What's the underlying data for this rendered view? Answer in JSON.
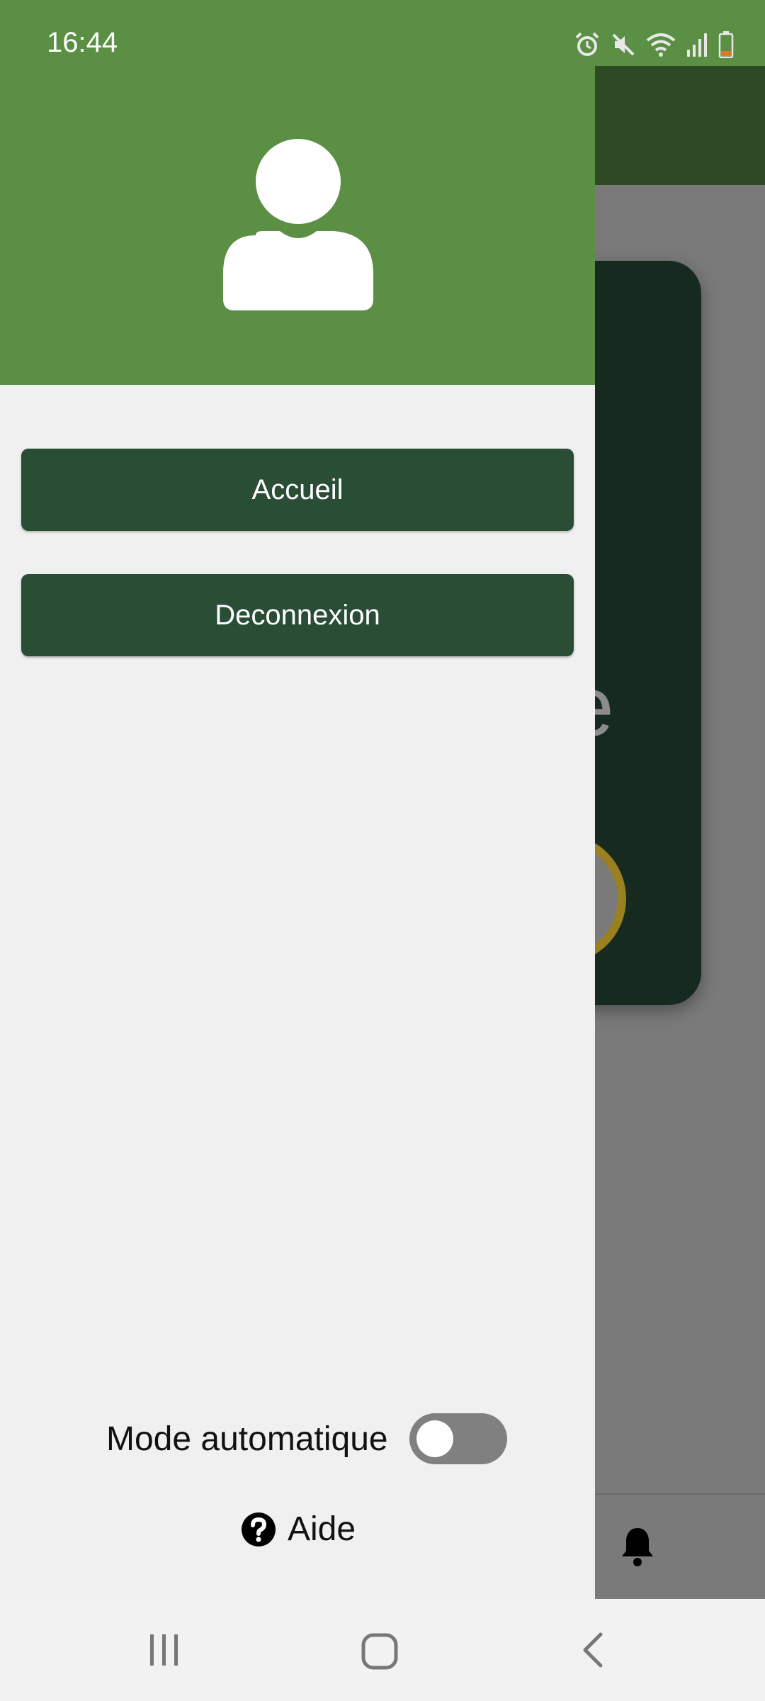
{
  "status_bar": {
    "time": "16:44",
    "icons": [
      "alarm-icon",
      "mute-icon",
      "wifi-icon",
      "signal-icon",
      "battery-low-icon"
    ]
  },
  "background": {
    "card_letter": "e"
  },
  "drawer": {
    "avatar_icon": "user-avatar-icon",
    "buttons": {
      "home_label": "Accueil",
      "logout_label": "Deconnexion"
    },
    "auto_mode": {
      "label": "Mode automatique",
      "enabled": false
    },
    "help": {
      "label": "Aide",
      "icon": "help-circle-icon"
    }
  },
  "colors": {
    "header_green": "#5a8f44",
    "button_dark_green": "#2a4d36",
    "drawer_bg": "#f0f0f0",
    "toggle_off": "#808080"
  },
  "system_nav": {
    "icons": [
      "recent-apps-icon",
      "home-icon",
      "back-icon"
    ]
  }
}
